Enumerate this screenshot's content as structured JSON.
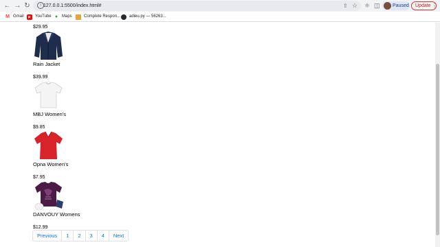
{
  "browser": {
    "url": "127.0.0.1:5500/index.html#",
    "profile_label": "Paused",
    "update_label": "Update",
    "bookmarks": [
      {
        "label": "Gmail",
        "icon": "gmail-icon"
      },
      {
        "label": "YouTube",
        "icon": "youtube-icon"
      },
      {
        "label": "Maps",
        "icon": "maps-icon"
      },
      {
        "label": "Complete Respon...",
        "icon": "bookmark-icon"
      },
      {
        "label": "adieu.py — 56263...",
        "icon": "github-icon"
      }
    ]
  },
  "products": {
    "top_price": "$29.95",
    "items": [
      {
        "title": "Rain Jacket",
        "price": "$39.99",
        "image": "jacket"
      },
      {
        "title": "MBJ Women's",
        "price": "$9.85",
        "image": "white-tee"
      },
      {
        "title": "Opna Women's",
        "price": "$7.95",
        "image": "red-tee"
      },
      {
        "title": "DANVOUY Womens",
        "price": "$12.99",
        "image": "purple-tee"
      }
    ]
  },
  "pagination": {
    "previous": "Previous",
    "pages": [
      "1",
      "2",
      "3",
      "4"
    ],
    "next": "Next"
  },
  "colors": {
    "link": "#0d6efd",
    "jacket": "#1f2d4d",
    "red_tee": "#d8232a",
    "purple_tee": "#4b1a45"
  }
}
